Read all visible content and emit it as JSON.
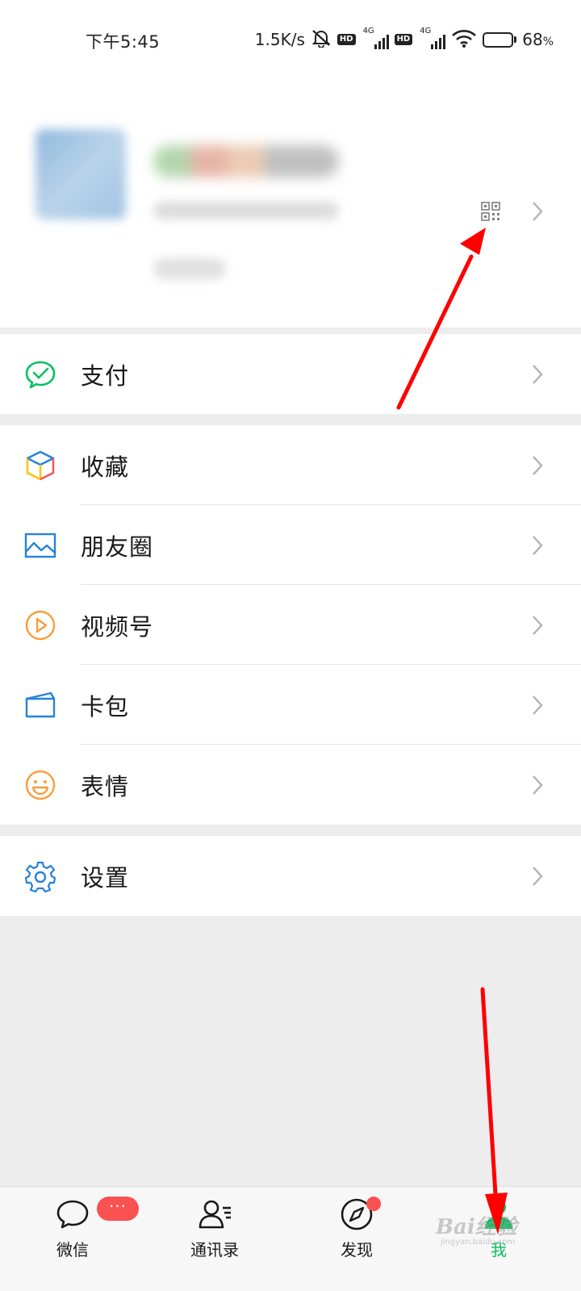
{
  "status_bar": {
    "time": "下午5:45",
    "network_speed": "1.5K/s",
    "hd1": "HD",
    "net1": "4G",
    "hd2": "HD",
    "net2": "4G",
    "battery_percent": "68",
    "battery_unit": "%",
    "battery_level": 0.68
  },
  "profile": {
    "qr_icon": "qr-code-icon",
    "chevron_icon": "chevron-right-icon"
  },
  "menu": {
    "pay": {
      "label": "支付",
      "icon": "pay-icon",
      "color": "#07c160"
    },
    "favorites": {
      "label": "收藏",
      "icon": "favorites-cube-icon"
    },
    "moments": {
      "label": "朋友圈",
      "icon": "moments-image-icon",
      "color": "#2782d7"
    },
    "channels": {
      "label": "视频号",
      "icon": "channels-play-icon",
      "color": "#fa9d3b"
    },
    "cards": {
      "label": "卡包",
      "icon": "card-wallet-icon",
      "color": "#2782d7"
    },
    "stickers": {
      "label": "表情",
      "icon": "sticker-smile-icon",
      "color": "#fa9d3b"
    },
    "settings": {
      "label": "设置",
      "icon": "gear-icon",
      "color": "#2782d7"
    }
  },
  "tabbar": {
    "chats": {
      "label": "微信",
      "badge": "···"
    },
    "contacts": {
      "label": "通讯录"
    },
    "discover": {
      "label": "发现"
    },
    "me": {
      "label": "我"
    }
  },
  "watermark": {
    "text": "Bai经验",
    "sub": "jingyan.baidu.com"
  },
  "colors": {
    "accent": "#07c160",
    "badge": "#fa5151",
    "annotation": "#ff0000"
  }
}
